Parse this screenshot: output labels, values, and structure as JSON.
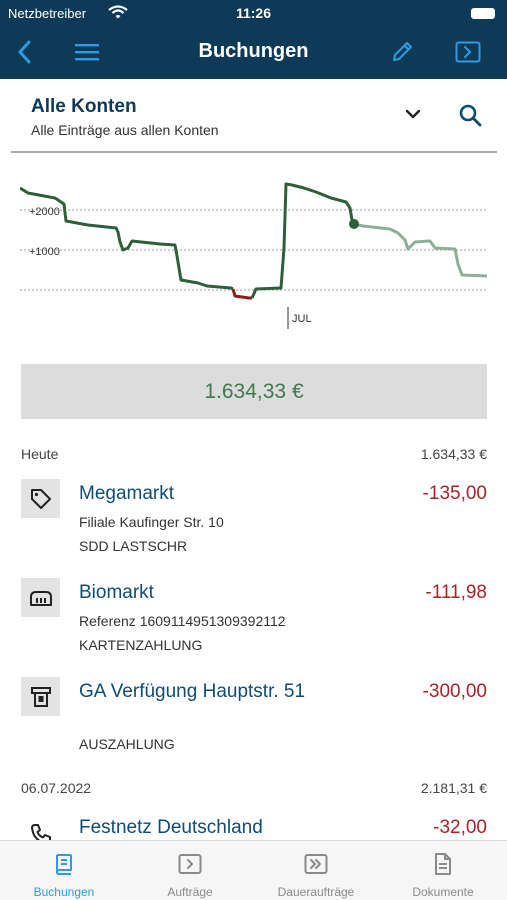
{
  "status_bar": {
    "carrier": "Netzbetreiber",
    "time": "11:26"
  },
  "navbar": {
    "title": "Buchungen"
  },
  "account": {
    "name": "Alle Konten",
    "description": "Alle Einträge aus allen Konten"
  },
  "chart": {
    "y_labels": [
      "+2000",
      "+1000"
    ],
    "month_marker": "JUL",
    "colors": {
      "line": "#2e5e3a",
      "negative": "#8b1c1c",
      "future": "#8fae98",
      "grid": "#9a9a9a"
    }
  },
  "balance": "1.634,33 €",
  "groups": [
    {
      "date": "Heute",
      "sum": "1.634,33 €",
      "transactions": [
        {
          "icon": "tag-icon",
          "name": "Megamarkt",
          "amount": "-135,00",
          "line1": "Filiale Kaufinger Str. 10",
          "line2": "SDD LASTSCHR"
        },
        {
          "icon": "card-reader-icon",
          "name": "Biomarkt",
          "amount": "-111,98",
          "line1": "Referenz 1609114951309392112",
          "line2": "KARTENZAHLUNG"
        },
        {
          "icon": "atm-icon",
          "name": "GA Verfügung Hauptstr. 51",
          "amount": "-300,00",
          "line1": "",
          "line2": "AUSZAHLUNG"
        }
      ]
    },
    {
      "date": "06.07.2022",
      "sum": "2.181,31 €",
      "transactions": [
        {
          "icon": "phone-icon",
          "name": "Festnetz Deutschland",
          "amount": "-32,00"
        }
      ]
    }
  ],
  "tabs": [
    {
      "label": "Buchungen",
      "icon": "book-icon",
      "active": true
    },
    {
      "label": "Aufträge",
      "icon": "transfer-icon",
      "active": false
    },
    {
      "label": "Daueraufträge",
      "icon": "standing-order-icon",
      "active": false
    },
    {
      "label": "Dokumente",
      "icon": "document-icon",
      "active": false
    }
  ],
  "colors": {
    "header_bg": "#0e3a57",
    "accent": "#2f9be0",
    "negative_amount": "#a5242b",
    "positive_balance": "#3d7a4c"
  }
}
